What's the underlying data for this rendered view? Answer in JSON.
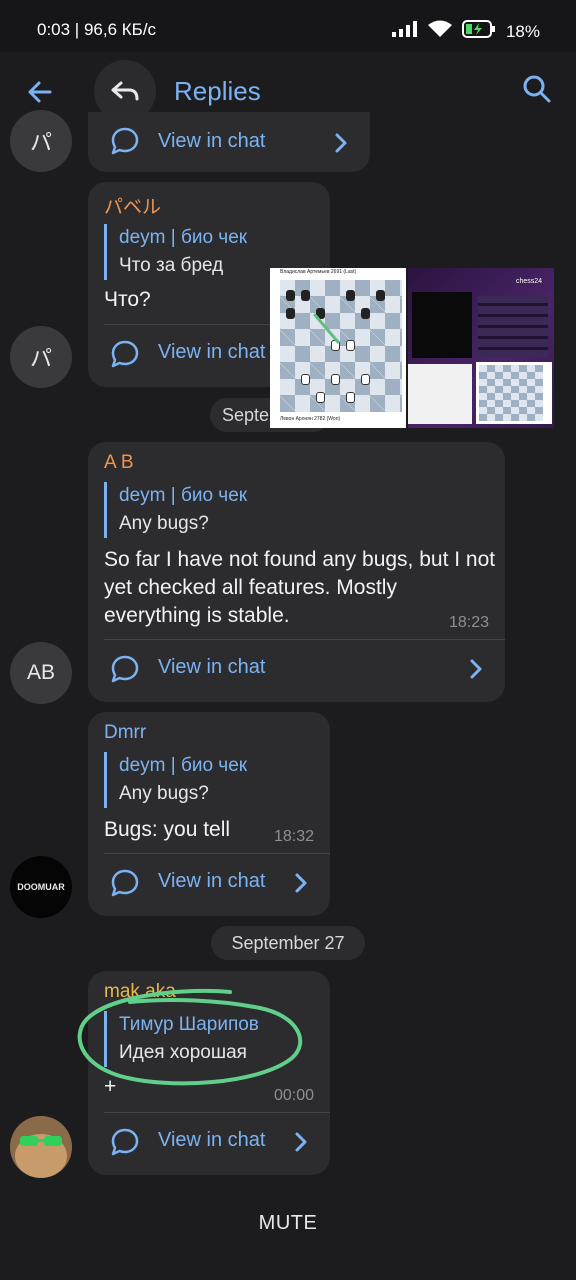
{
  "status_bar": {
    "left_text": "0:03 | 96,6 КБ/с",
    "battery": "18%"
  },
  "header": {
    "title": "Replies"
  },
  "colors": {
    "accent": "#7bb3f2",
    "bubble": "#2c2c2f",
    "background": "#1c1c1e",
    "annotation": "#5fcf8a"
  },
  "view_in_chat": "View in chat",
  "avatars": {
    "top": "パ",
    "pavel": "パ",
    "ab": "AB",
    "dmrr": "DOOMUAR"
  },
  "messages": [
    {
      "sender": "パベル",
      "sender_color": "#f0954f",
      "quote_name": "deym | био чек",
      "quote_text": "Что за бред",
      "text": "Что?"
    },
    {
      "sender": "A B",
      "sender_color": "#f0954f",
      "quote_name": "deym | био чек",
      "quote_text": "Any bugs?",
      "text": "So far I have not found any bugs, but I not yet checked all features. Mostly everything is stable.",
      "time": "18:23"
    },
    {
      "sender": "Dmrr",
      "sender_color": "#7bb3f2",
      "quote_name": "deym | био чек",
      "quote_text": "Any bugs?",
      "text": "Bugs: you tell",
      "time": "18:32"
    },
    {
      "sender": "mak aka",
      "sender_color": "#e8b84a",
      "quote_name": "Тимур Шарипов",
      "quote_text": "Идея хорошая",
      "text": "+",
      "time": "00:00"
    }
  ],
  "date_separators": [
    "Septe",
    "September 27"
  ],
  "thumbnail": {
    "player_top": "Владислав Артемьев 2691 (Last)",
    "player_bottom": "Левон Аронян 2782 (Won)",
    "brand": "chess24"
  },
  "footer": {
    "mute_label": "MUTE"
  }
}
